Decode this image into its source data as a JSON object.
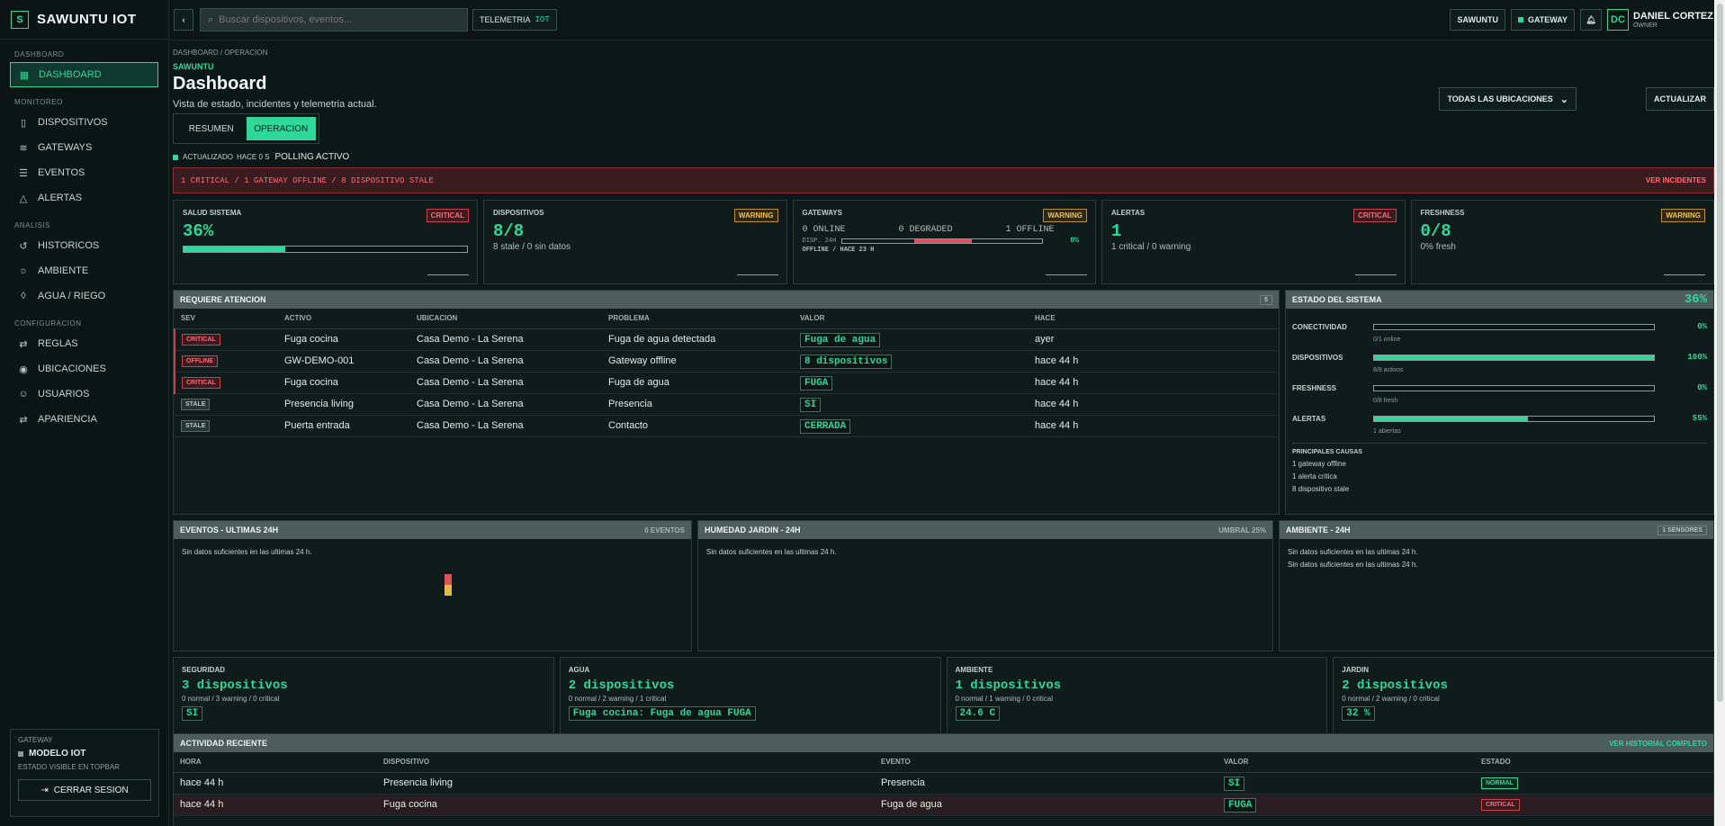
{
  "brand": {
    "mark": "S",
    "name": "SAWUNTU IOT"
  },
  "sidebar": {
    "sections": [
      {
        "title": "DASHBOARD",
        "items": [
          {
            "label": "DASHBOARD",
            "icon": "dashboard-icon",
            "active": true
          }
        ]
      },
      {
        "title": "MONITOREO",
        "items": [
          {
            "label": "DISPOSITIVOS",
            "icon": "device-icon"
          },
          {
            "label": "GATEWAYS",
            "icon": "wifi-icon"
          },
          {
            "label": "EVENTOS",
            "icon": "list-icon"
          },
          {
            "label": "ALERTAS",
            "icon": "alert-icon"
          }
        ]
      },
      {
        "title": "ANALISIS",
        "items": [
          {
            "label": "HISTORICOS",
            "icon": "history-icon"
          },
          {
            "label": "AMBIENTE",
            "icon": "sun-icon"
          },
          {
            "label": "AGUA / RIEGO",
            "icon": "drop-icon"
          }
        ]
      },
      {
        "title": "CONFIGURACION",
        "items": [
          {
            "label": "REGLAS",
            "icon": "sliders-icon"
          },
          {
            "label": "UBICACIONES",
            "icon": "pin-icon"
          },
          {
            "label": "USUARIOS",
            "icon": "users-icon"
          },
          {
            "label": "APARIENCIA",
            "icon": "palette-icon"
          }
        ]
      }
    ],
    "gateway_box": {
      "caption": "GATEWAY",
      "model": "MODELO IOT",
      "note": "ESTADO VISIBLE EN TOPBAR",
      "logout": "CERRAR SESION"
    }
  },
  "topbar": {
    "search_placeholder": "Buscar dispositivos, eventos...",
    "telemetry_label": "TELEMETRIA",
    "telemetry_tag": "IOT",
    "org_button": "SAWUNTU",
    "gateway_button": "GATEWAY",
    "avatar": "DC",
    "user_name": "DANIEL CORTEZ",
    "user_role": "OWNER"
  },
  "header": {
    "breadcrumb": "DASHBOARD / OPERACION",
    "org": "SAWUNTU",
    "title": "Dashboard",
    "subtitle": "Vista de estado, incidentes y telemetria actual.",
    "tabs": [
      {
        "label": "RESUMEN"
      },
      {
        "label": "OPERACION",
        "active": true
      }
    ],
    "updated": "ACTUALIZADO",
    "updated_ago": "HACE 0 S",
    "polling": "POLLING ACTIVO",
    "location_select": "TODAS LAS UBICACIONES",
    "refresh": "ACTUALIZAR"
  },
  "banner": {
    "text": "1 CRITICAL / 1 GATEWAY OFFLINE / 8 DISPOSITIVO STALE",
    "link": "VER INCIDENTES"
  },
  "kpis": {
    "health": {
      "title": "SALUD SISTEMA",
      "value": "36%",
      "badge": "CRITICAL",
      "progress": 0.36
    },
    "devices": {
      "title": "DISPOSITIVOS",
      "value": "8/8",
      "sub": "8 stale / 0 sin datos",
      "badge": "WARNING"
    },
    "gateways": {
      "title": "GATEWAYS",
      "online": "0 ONLINE",
      "degraded": "0 DEGRADED",
      "offline": "1 OFFLINE",
      "disp_label": "DISP. 24H",
      "disp_pct": "0%",
      "offline_note": "OFFLINE / HACE 23 H",
      "badge": "WARNING"
    },
    "alerts": {
      "title": "ALERTAS",
      "value": "1",
      "sub": "1 critical / 0 warning",
      "badge": "CRITICAL"
    },
    "freshness": {
      "title": "FRESHNESS",
      "value": "0/8",
      "sub": "0% fresh",
      "badge": "WARNING"
    }
  },
  "attention": {
    "title": "REQUIERE ATENCION",
    "count": "5",
    "columns": [
      "SEV",
      "ACTIVO",
      "UBICACION",
      "PROBLEMA",
      "VALOR",
      "HACE"
    ],
    "rows": [
      {
        "sev": "CRITICAL",
        "asset": "Fuga cocina",
        "location": "Casa Demo - La Serena",
        "problem": "Fuga de agua detectada",
        "value": "Fuga de agua",
        "ago": "ayer"
      },
      {
        "sev": "OFFLINE",
        "asset": "GW-DEMO-001",
        "location": "Casa Demo - La Serena",
        "problem": "Gateway offline",
        "value": "8 dispositivos",
        "ago": "hace 44 h"
      },
      {
        "sev": "CRITICAL",
        "asset": "Fuga cocina",
        "location": "Casa Demo - La Serena",
        "problem": "Fuga de agua",
        "value": "FUGA",
        "ago": "hace 44 h"
      },
      {
        "sev": "STALE",
        "asset": "Presencia living",
        "location": "Casa Demo - La Serena",
        "problem": "Presencia",
        "value": "SI",
        "ago": "hace 44 h"
      },
      {
        "sev": "STALE",
        "asset": "Puerta entrada",
        "location": "Casa Demo - La Serena",
        "problem": "Contacto",
        "value": "CERRADA",
        "ago": "hace 44 h"
      }
    ]
  },
  "system": {
    "title": "ESTADO DEL SISTEMA",
    "score": "36%",
    "rows": [
      {
        "label": "CONECTIVIDAD",
        "pct": "0%",
        "fraction": 0.0,
        "note": "0/1 online"
      },
      {
        "label": "DISPOSITIVOS",
        "pct": "100%",
        "fraction": 1.0,
        "note": "8/8 activos"
      },
      {
        "label": "FRESHNESS",
        "pct": "0%",
        "fraction": 0.0,
        "note": "0/8 fresh"
      },
      {
        "label": "ALERTAS",
        "pct": "55%",
        "fraction": 0.55,
        "note": "1 abiertas"
      }
    ],
    "causes_title": "PRINCIPALES CAUSAS",
    "causes": [
      "1 gateway offline",
      "1 alerta critica",
      "8 dispositivo stale"
    ]
  },
  "events_panel": {
    "title": "EVENTOS - ULTIMAS 24H",
    "meta": "0 EVENTOS",
    "empty": "Sin datos suficientes en las ultimas 24 h."
  },
  "humidity_panel": {
    "title": "HUMEDAD JARDIN - 24H",
    "meta": "UMBRAL 25%",
    "empty": "Sin datos suficientes en las ultimas 24 h."
  },
  "ambient_panel": {
    "title": "AMBIENTE - 24H",
    "meta": "1 SENSORES",
    "empty1": "Sin datos suficientes en las ultimas 24 h.",
    "empty2": "Sin datos suficientes en las ultimas 24 h."
  },
  "categories": [
    {
      "title": "SEGURIDAD",
      "value": "3 dispositivos",
      "sub": "0 normal / 3 warning / 0 critical",
      "chip": "SI"
    },
    {
      "title": "AGUA",
      "value": "2 dispositivos",
      "sub": "0 normal / 2 warning / 1 critical",
      "chip": "Fuga cocina: Fuga de agua FUGA"
    },
    {
      "title": "AMBIENTE",
      "value": "1 dispositivos",
      "sub": "0 normal / 1 warning / 0 critical",
      "chip": "24.6 C"
    },
    {
      "title": "JARDIN",
      "value": "2 dispositivos",
      "sub": "0 normal / 2 warning / 0 critical",
      "chip": "32 %"
    }
  ],
  "activity": {
    "title": "ACTIVIDAD RECIENTE",
    "link": "VER HISTORIAL COMPLETO",
    "columns": [
      "HORA",
      "DISPOSITIVO",
      "EVENTO",
      "VALOR",
      "ESTADO"
    ],
    "rows": [
      {
        "time": "hace 44 h",
        "device": "Presencia living",
        "event": "Presencia",
        "value": "SI",
        "status": "NORMAL"
      },
      {
        "time": "hace 44 h",
        "device": "Fuga cocina",
        "event": "Fuga de agua",
        "value": "FUGA",
        "status": "CRITICAL"
      }
    ]
  }
}
